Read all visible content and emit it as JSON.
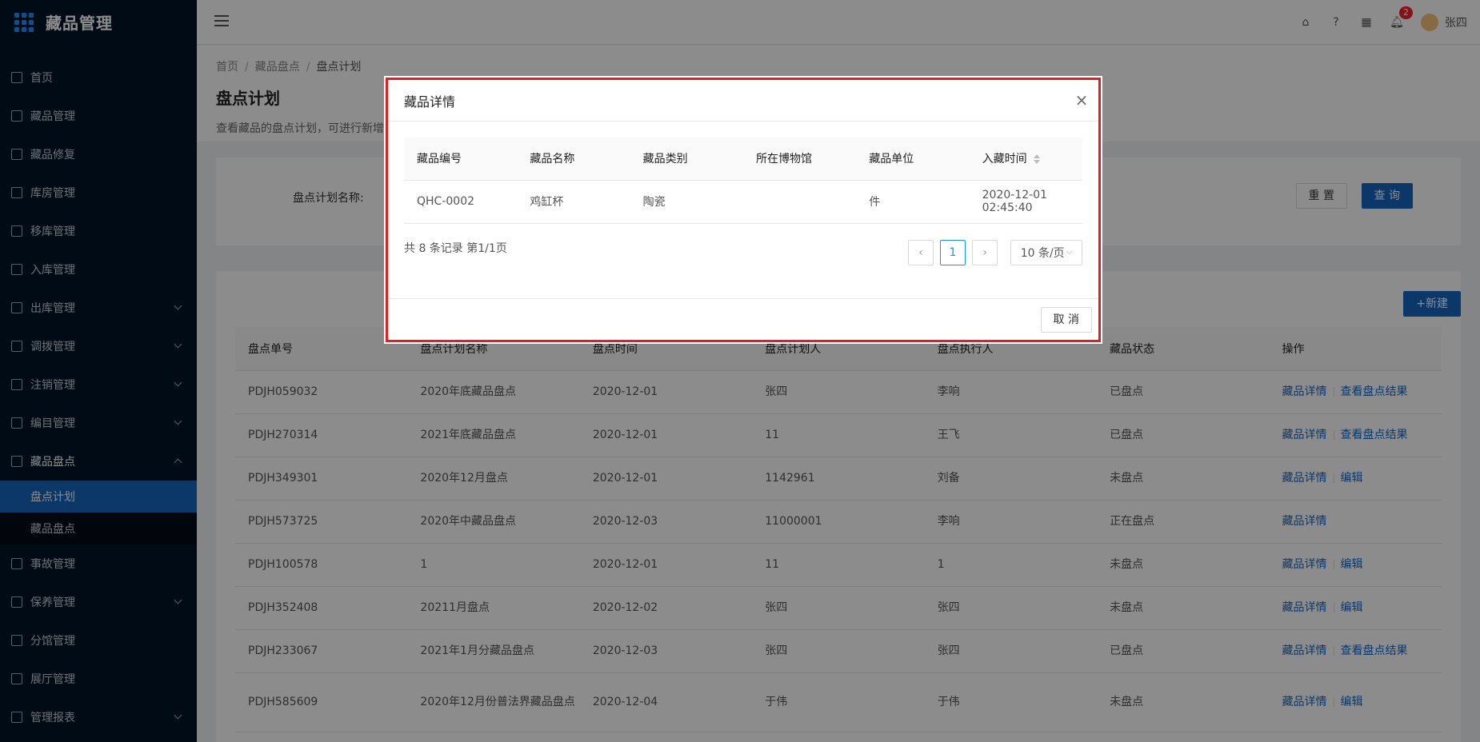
{
  "app": {
    "title": "藏品管理"
  },
  "sidebar": {
    "items": [
      {
        "label": "首页",
        "has_caret": false
      },
      {
        "label": "藏品管理",
        "has_caret": false
      },
      {
        "label": "藏品修复",
        "has_caret": false
      },
      {
        "label": "库房管理",
        "has_caret": false
      },
      {
        "label": "移库管理",
        "has_caret": false
      },
      {
        "label": "入库管理",
        "has_caret": false
      },
      {
        "label": "出库管理",
        "has_caret": true
      },
      {
        "label": "调拨管理",
        "has_caret": true
      },
      {
        "label": "注销管理",
        "has_caret": true
      },
      {
        "label": "编目管理",
        "has_caret": true
      },
      {
        "label": "藏品盘点",
        "has_caret": true,
        "open": true
      },
      {
        "label": "事故管理",
        "has_caret": false
      },
      {
        "label": "保养管理",
        "has_caret": true
      },
      {
        "label": "分馆管理",
        "has_caret": false
      },
      {
        "label": "展厅管理",
        "has_caret": false
      },
      {
        "label": "管理报表",
        "has_caret": true
      }
    ],
    "subitems": [
      {
        "label": "盘点计划",
        "active": true
      },
      {
        "label": "藏品盘点",
        "active": false
      }
    ]
  },
  "header": {
    "notification_count": "2",
    "user_name": "张四"
  },
  "page": {
    "breadcrumb": [
      "首页",
      "藏品盘点",
      "盘点计划"
    ],
    "title": "盘点计划",
    "description": "查看藏品的盘点计划，可进行新增"
  },
  "search": {
    "label": "盘点计划名称:",
    "reset_label": "重 置",
    "query_label": "查 询"
  },
  "table": {
    "new_label": "+新建",
    "columns": [
      "盘点单号",
      "盘点计划名称",
      "盘点时间",
      "盘点计划人",
      "盘点执行人",
      "藏品状态",
      "操作"
    ],
    "rows": [
      {
        "id": "PDJH059032",
        "name": "2020年底藏品盘点",
        "time": "2020-12-01",
        "planner": "张四",
        "executor": "李响",
        "status": "已盘点",
        "ops": [
          "藏品详情",
          "查看盘点结果"
        ]
      },
      {
        "id": "PDJH270314",
        "name": "2021年底藏品盘点",
        "time": "2020-12-01",
        "planner": "11",
        "executor": "王飞",
        "status": "已盘点",
        "ops": [
          "藏品详情",
          "查看盘点结果"
        ]
      },
      {
        "id": "PDJH349301",
        "name": "2020年12月盘点",
        "time": "2020-12-01",
        "planner": "1142961",
        "executor": "刘备",
        "status": "未盘点",
        "ops": [
          "藏品详情",
          "编辑"
        ]
      },
      {
        "id": "PDJH573725",
        "name": "2020年中藏品盘点",
        "time": "2020-12-03",
        "planner": "11000001",
        "executor": "李响",
        "status": "正在盘点",
        "ops": [
          "藏品详情"
        ]
      },
      {
        "id": "PDJH100578",
        "name": "1",
        "time": "2020-12-01",
        "planner": "11",
        "executor": "1",
        "status": "未盘点",
        "ops": [
          "藏品详情",
          "编辑"
        ]
      },
      {
        "id": "PDJH352408",
        "name": "20211月盘点",
        "time": "2020-12-02",
        "planner": "张四",
        "executor": "张四",
        "status": "未盘点",
        "ops": [
          "藏品详情",
          "编辑"
        ]
      },
      {
        "id": "PDJH233067",
        "name": "2021年1月分藏品盘点",
        "time": "2020-12-03",
        "planner": "张四",
        "executor": "张四",
        "status": "已盘点",
        "ops": [
          "藏品详情",
          "查看盘点结果"
        ]
      },
      {
        "id": "PDJH585609",
        "name": "2020年12月份普法界藏品盘点",
        "time": "2020-12-04",
        "planner": "于伟",
        "executor": "于伟",
        "status": "未盘点",
        "ops": [
          "藏品详情",
          "编辑"
        ]
      }
    ]
  },
  "modal": {
    "title": "藏品详情",
    "columns": [
      "藏品编号",
      "藏品名称",
      "藏品类别",
      "所在博物馆",
      "藏品单位",
      "入藏时间"
    ],
    "rows": [
      {
        "code": "QHC-0002",
        "name": "鸡缸杯",
        "category": "陶瓷",
        "museum": "",
        "unit": "件",
        "time": "2020-12-01 02:45:40"
      }
    ],
    "total_text": "共 8 条记录 第1/1页",
    "current_page": "1",
    "page_size": "10 条/页",
    "cancel_label": "取 消"
  },
  "colors": {
    "sidebar_bg": "#001529",
    "primary": "#1565c0",
    "highlight_border": "#e02020"
  }
}
